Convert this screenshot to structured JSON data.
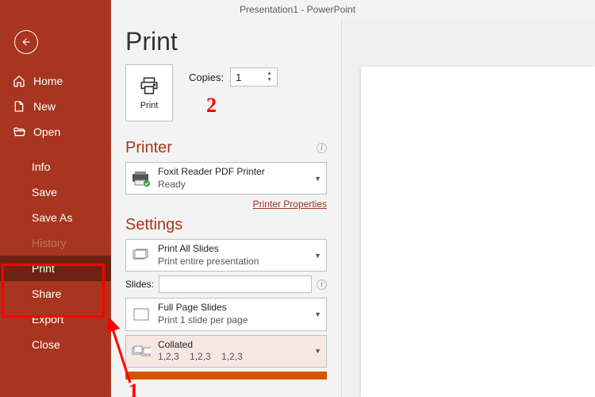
{
  "title": "Presentation1  -  PowerPoint",
  "colors": {
    "accent": "#a7351f",
    "annotation": "#ff0000"
  },
  "sidebar": {
    "back": "←",
    "top_items": [
      {
        "label": "Home",
        "icon": "home-icon"
      },
      {
        "label": "New",
        "icon": "new-icon"
      },
      {
        "label": "Open",
        "icon": "open-icon"
      }
    ],
    "bottom_items": [
      {
        "label": "Info"
      },
      {
        "label": "Save"
      },
      {
        "label": "Save As"
      },
      {
        "label": "History"
      },
      {
        "label": "Print",
        "selected": true
      },
      {
        "label": "Share"
      },
      {
        "label": "Export"
      },
      {
        "label": "Close"
      }
    ]
  },
  "page": {
    "heading": "Print",
    "print_button": "Print",
    "copies_label": "Copies:",
    "copies_value": "1",
    "printer_section": "Printer",
    "printer": {
      "name": "Foxit Reader PDF Printer",
      "status": "Ready"
    },
    "printer_props_link": "Printer Properties",
    "settings_section": "Settings",
    "slides_label": "Slides:",
    "slides_value": "",
    "settings": [
      {
        "title": "Print All Slides",
        "sub": "Print entire presentation",
        "icon": "slides"
      },
      {
        "title": "Full Page Slides",
        "sub": "Print 1 slide per page",
        "icon": "page"
      },
      {
        "title": "Collated",
        "sub": "1,2,3    1,2,3    1,2,3",
        "icon": "collate"
      }
    ]
  },
  "annotations": {
    "one": "1",
    "two": "2"
  }
}
